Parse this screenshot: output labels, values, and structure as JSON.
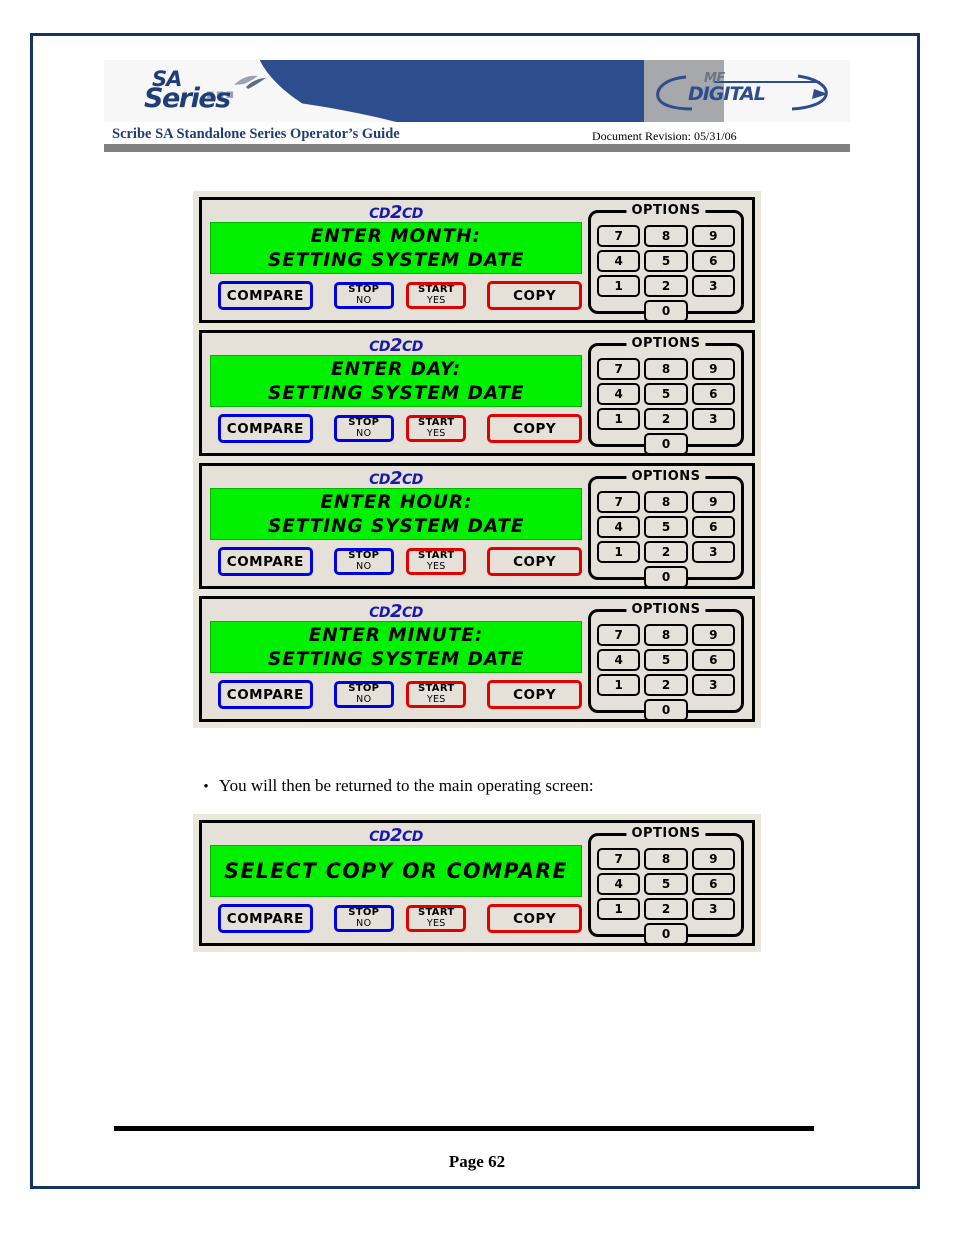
{
  "document": {
    "guide_title": "Scribe SA Standalone Series Operator’s Guide",
    "revision": "Document Revision: 05/31/06",
    "page_number": "Page 62",
    "body_text": "You will then be returned to the main operating screen:",
    "bullet_glyph": "•"
  },
  "brand": {
    "sa_line1": "SA",
    "sa_line2": "Series",
    "sa_dots": "▪▪▪",
    "mf_small": "MF",
    "mf_big": "DIGITAL",
    "accent_blue": "#2d4d8e",
    "accent_gray": "#a6a8ab",
    "title_blue": "#1f3e77"
  },
  "device": {
    "logo_prefix": "CD",
    "logo_mid": "2",
    "logo_suffix": "CD",
    "options_legend": "OPTIONS",
    "keys": [
      "7",
      "8",
      "9",
      "4",
      "5",
      "6",
      "1",
      "2",
      "3"
    ],
    "key_zero": "0",
    "buttons": {
      "compare": "COMPARE",
      "stop_top": "STOP",
      "stop_bottom": "NO",
      "start_top": "START",
      "start_bottom": "YES",
      "copy": "COPY"
    },
    "colors": {
      "lcd_background": "#00f000",
      "lcd_text": "#000000",
      "panel_face": "#e5e0d8",
      "panel_surround": "#eae7dc",
      "blue_button_border": "#0000e0",
      "red_button_border": "#e00000",
      "logo_blue": "#1a1aa8"
    }
  },
  "panels": [
    {
      "id": "enter-month",
      "line1": "ENTER MONTH:",
      "line2": "SETTING SYSTEM DATE"
    },
    {
      "id": "enter-day",
      "line1": "ENTER DAY:",
      "line2": "SETTING SYSTEM DATE"
    },
    {
      "id": "enter-hour",
      "line1": "ENTER HOUR:",
      "line2": "SETTING SYSTEM DATE"
    },
    {
      "id": "enter-minute",
      "line1": "ENTER MINUTE:",
      "line2": "SETTING SYSTEM DATE"
    }
  ],
  "main_panel": {
    "id": "select-copy-or-compare",
    "line1": "SELECT COPY OR COMPARE",
    "line2": ""
  }
}
